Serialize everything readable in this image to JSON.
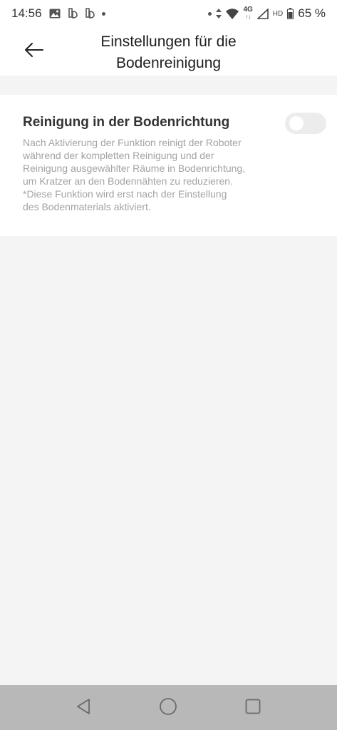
{
  "status_bar": {
    "time": "14:56",
    "network": "4G",
    "network_sub": "↑↓",
    "hd_label": "HD",
    "battery": "65 %",
    "icons": [
      "gallery-icon",
      "app-icon",
      "app-icon",
      "dot-icon",
      "dot-icon",
      "data-arrows-icon",
      "wifi-icon",
      "signal-icon",
      "battery-icon"
    ]
  },
  "header": {
    "title": "Einstellungen für die\nBodenreinigung",
    "back_icon": "arrow-left-icon"
  },
  "setting": {
    "title": "Reinigung in der Bodenrichtung",
    "description": "Nach Aktivierung der Funktion reinigt der Roboter\nwährend der kompletten Reinigung und der\nReinigung ausgewählter Räume in Bodenrichtung,\num Kratzer an den Bodennähten zu reduzieren.\n*Diese Funktion wird erst nach der Einstellung\ndes Bodenmaterials aktiviert.",
    "enabled": false
  },
  "nav_bar": {
    "icons": [
      "back-triangle-icon",
      "home-circle-icon",
      "recents-square-icon"
    ]
  },
  "colors": {
    "background": "#f4f4f4",
    "card": "#ffffff",
    "toggle_off": "#ececec",
    "nav_bar": "#b8b8b8"
  }
}
